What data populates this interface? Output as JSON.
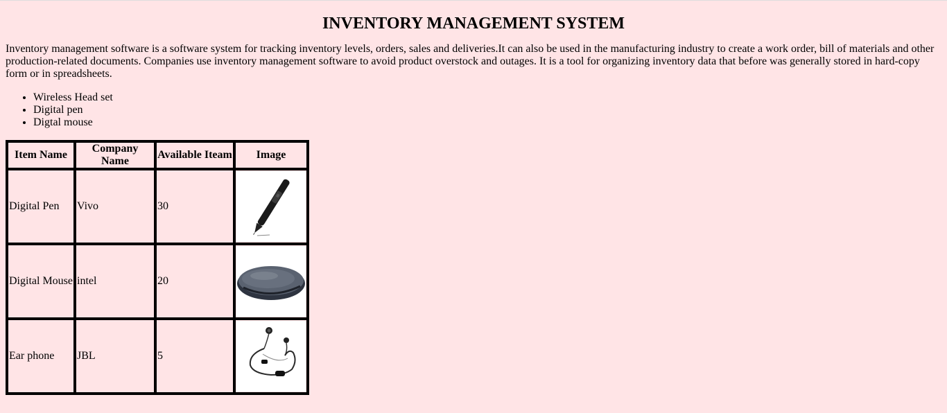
{
  "page": {
    "title": "INVENTORY MANAGEMENT SYSTEM",
    "intro": "Inventory management software is a software system for tracking inventory levels, orders, sales and deliveries.It can also be used in the manufacturing industry to create a work order, bill of materials and other production-related documents. Companies use inventory management software to avoid product overstock and outages. It is a tool for organizing inventory data that before was generally stored in hard-copy form or in spreadsheets."
  },
  "features": [
    "Wireless Head set",
    "Digital pen",
    "Digtal mouse"
  ],
  "table": {
    "headers": [
      "Item Name",
      "Company Name",
      "Available Iteam",
      "Image"
    ],
    "rows": [
      {
        "item": "Digital Pen",
        "company": "Vivo",
        "available": "30",
        "image_icon": "digital-pen-image"
      },
      {
        "item": "Digital Mouse",
        "company": "intel",
        "available": "20",
        "image_icon": "digital-mouse-image"
      },
      {
        "item": "Ear phone",
        "company": "JBL",
        "available": "5",
        "image_icon": "earphone-image"
      }
    ]
  },
  "colors": {
    "background": "#ffe4e6",
    "border": "#000000"
  }
}
